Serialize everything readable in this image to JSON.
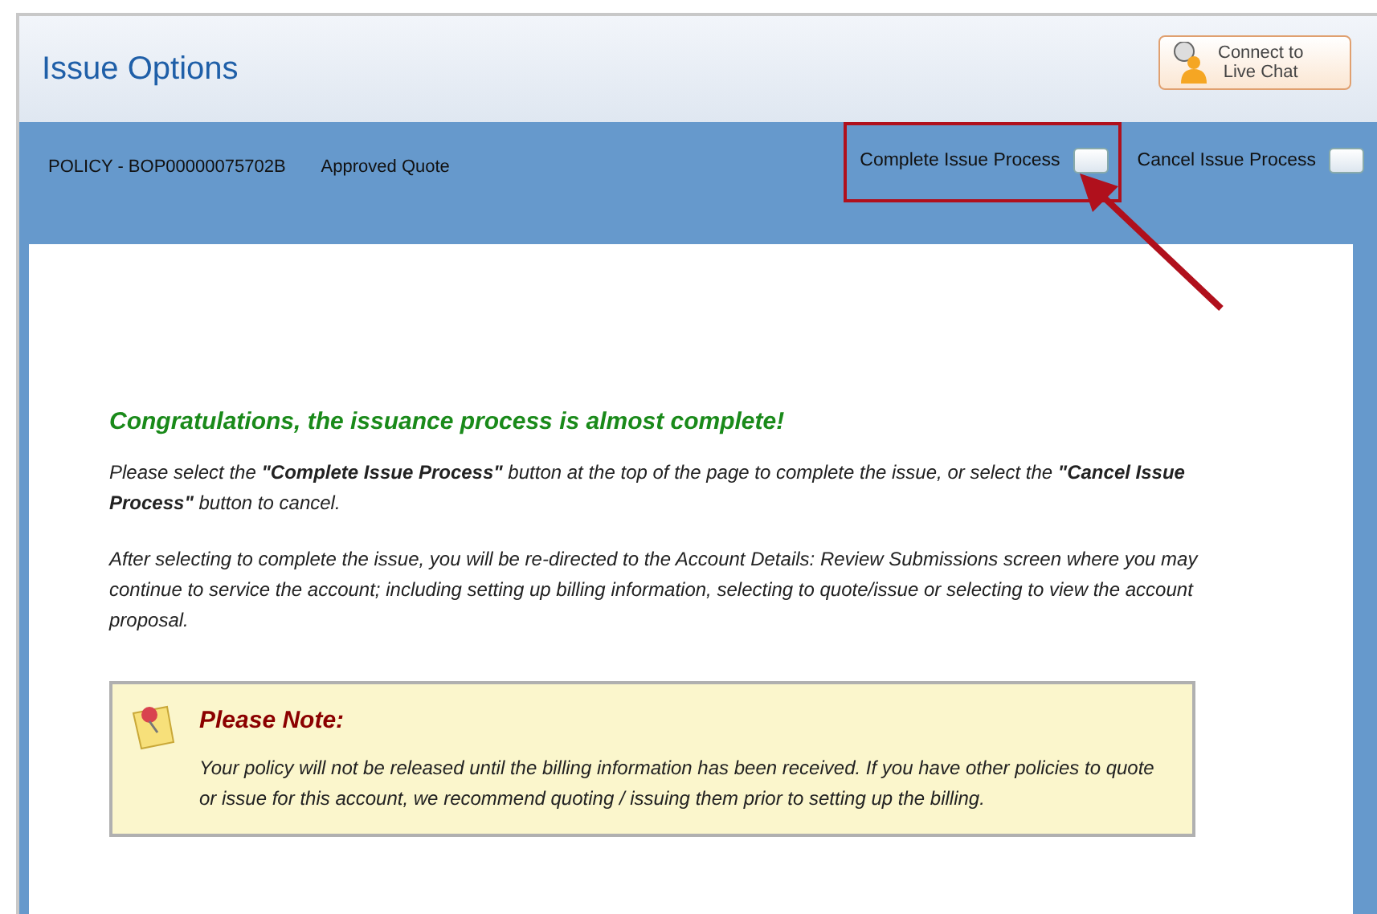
{
  "header": {
    "title": "Issue Options",
    "chat_button": "Connect to\nLive Chat"
  },
  "toolbar": {
    "policy": "POLICY - BOP00000075702B",
    "status": "Approved Quote",
    "actions": [
      {
        "label": "Complete Issue Process",
        "highlighted": true
      },
      {
        "label": "Cancel Issue Process",
        "highlighted": false
      }
    ]
  },
  "content": {
    "heading": "Congratulations, the issuance process is almost complete!",
    "paragraphs": [
      "Please select the **\"Complete Issue Process\"** button at the top of the page to complete the issue, or select the **\"Cancel Issue Process\"** button to cancel.",
      "After selecting to complete the issue, you will be re-directed to the Account Details: Review Submissions screen where you may continue to service the account; including setting up billing information, selecting to quote/issue or selecting to view the account proposal."
    ],
    "note": {
      "title": "Please Note:",
      "text": "Your policy will not be released until the billing information has been received. If you have other policies to quote or issue for this account, we recommend quoting / issuing them prior to setting up the billing."
    }
  }
}
